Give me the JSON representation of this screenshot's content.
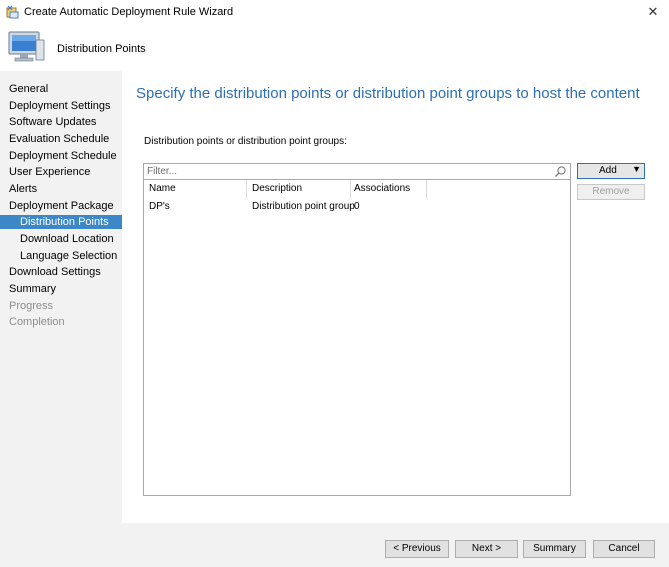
{
  "window": {
    "title": "Create Automatic Deployment Rule Wizard",
    "close_glyph": "✕"
  },
  "header": {
    "title": "Distribution Points",
    "icon": "computer-icon"
  },
  "sidebar": {
    "items": [
      {
        "label": "General",
        "state": "normal"
      },
      {
        "label": "Deployment Settings",
        "state": "normal"
      },
      {
        "label": "Software Updates",
        "state": "normal"
      },
      {
        "label": "Evaluation Schedule",
        "state": "normal"
      },
      {
        "label": "Deployment Schedule",
        "state": "normal"
      },
      {
        "label": "User Experience",
        "state": "normal"
      },
      {
        "label": "Alerts",
        "state": "normal"
      },
      {
        "label": "Deployment Package",
        "state": "normal"
      },
      {
        "label": "Distribution Points",
        "state": "active"
      },
      {
        "label": "Download Location",
        "state": "normal"
      },
      {
        "label": "Language Selection",
        "state": "normal"
      },
      {
        "label": "Download Settings",
        "state": "normal"
      },
      {
        "label": "Summary",
        "state": "normal"
      },
      {
        "label": "Progress",
        "state": "disabled"
      },
      {
        "label": "Completion",
        "state": "disabled"
      }
    ]
  },
  "main": {
    "heading": "Specify the distribution points or distribution point groups to host the content",
    "list_label": "Distribution points or distribution point groups:",
    "filter": {
      "placeholder": "Filter...",
      "value": ""
    },
    "columns": [
      "Name",
      "Description",
      "Associations"
    ],
    "rows": [
      {
        "name": "DP's",
        "description": "Distribution point group",
        "associations": "0"
      }
    ],
    "add_button": "Add",
    "remove_button": "Remove"
  },
  "footer": {
    "previous": "< Previous",
    "next": "Next >",
    "summary": "Summary",
    "cancel": "Cancel"
  },
  "colors": {
    "heading": "#2c6fb5",
    "active_nav": "#3c87c8",
    "sidebar_bg": "#f2f2f2"
  }
}
